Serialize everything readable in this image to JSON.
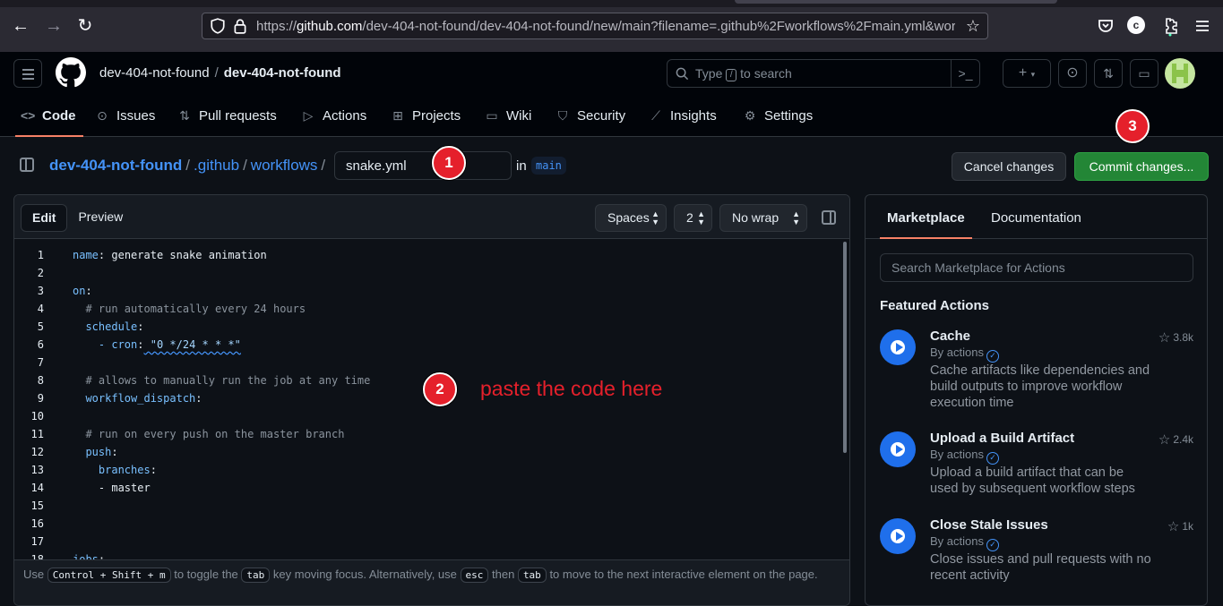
{
  "browser": {
    "url_prefix": "https://",
    "url_host": "github.com",
    "url_path": "/dev-404-not-found/dev-404-not-found/new/main?filename=.github%2Fworkflows%2Fmain.yml&wor",
    "profile_letter": "c"
  },
  "header": {
    "owner": "dev-404-not-found",
    "separator": "/",
    "repo": "dev-404-not-found",
    "search_prefix": "Type",
    "search_key": "/",
    "search_suffix": "to search"
  },
  "repo_nav": [
    {
      "label": "Code",
      "icon": "code-icon",
      "glyph": "<>"
    },
    {
      "label": "Issues",
      "icon": "issue-icon",
      "glyph": "⊙"
    },
    {
      "label": "Pull requests",
      "icon": "pull-request-icon",
      "glyph": "⇅"
    },
    {
      "label": "Actions",
      "icon": "play-icon",
      "glyph": "▷"
    },
    {
      "label": "Projects",
      "icon": "table-icon",
      "glyph": "⊞"
    },
    {
      "label": "Wiki",
      "icon": "book-icon",
      "glyph": "▭"
    },
    {
      "label": "Security",
      "icon": "shield-icon",
      "glyph": "⛉"
    },
    {
      "label": "Insights",
      "icon": "graph-icon",
      "glyph": "⟋"
    },
    {
      "label": "Settings",
      "icon": "gear-icon",
      "glyph": "⚙"
    }
  ],
  "file_bar": {
    "crumbs": [
      "dev-404-not-found",
      ".github",
      "workflows"
    ],
    "separator": "/",
    "filename": "snake.yml",
    "in_label": "in",
    "branch": "main",
    "cancel_label": "Cancel changes",
    "commit_label": "Commit changes..."
  },
  "editor": {
    "edit_tab": "Edit",
    "preview_tab": "Preview",
    "indent_mode": "Spaces",
    "indent_size": "2",
    "wrap_mode": "No wrap",
    "lines": [
      {
        "n": "1",
        "indent": "",
        "key": "name",
        "punct": ":",
        "val": " generate snake animation",
        "type": "kv"
      },
      {
        "n": "2",
        "indent": "",
        "type": "blank"
      },
      {
        "n": "3",
        "indent": "",
        "key": "on",
        "punct": ":",
        "val": "",
        "type": "kv"
      },
      {
        "n": "4",
        "indent": "  ",
        "comment": "# run automatically every 24 hours",
        "type": "comment"
      },
      {
        "n": "5",
        "indent": "  ",
        "key": "schedule",
        "punct": ":",
        "val": "",
        "type": "kv"
      },
      {
        "n": "6",
        "indent": "    ",
        "key": "- cron",
        "punct": ":",
        "val": " \"0 */24 * * *\"",
        "type": "cron"
      },
      {
        "n": "7",
        "indent": "",
        "type": "blank"
      },
      {
        "n": "8",
        "indent": "  ",
        "comment": "# allows to manually run the job at any time",
        "type": "comment"
      },
      {
        "n": "9",
        "indent": "  ",
        "key": "workflow_dispatch",
        "punct": ":",
        "val": "",
        "type": "kv"
      },
      {
        "n": "10",
        "indent": "",
        "type": "blank"
      },
      {
        "n": "11",
        "indent": "  ",
        "comment": "# run on every push on the master branch",
        "type": "comment"
      },
      {
        "n": "12",
        "indent": "  ",
        "key": "push",
        "punct": ":",
        "val": "",
        "type": "kv"
      },
      {
        "n": "13",
        "indent": "    ",
        "key": "branches",
        "punct": ":",
        "val": "",
        "type": "kv"
      },
      {
        "n": "14",
        "indent": "    ",
        "key": "",
        "punct": "",
        "val": "- master",
        "type": "plain"
      },
      {
        "n": "15",
        "indent": "",
        "type": "blank"
      },
      {
        "n": "16",
        "indent": "",
        "type": "blank"
      },
      {
        "n": "17",
        "indent": "",
        "type": "blank"
      },
      {
        "n": "18",
        "indent": "",
        "key": "jobs",
        "punct": ":",
        "val": "",
        "type": "kv"
      }
    ],
    "footer": {
      "t1": "Use",
      "k1": "Control + Shift + m",
      "t2": "to toggle the",
      "k2": "tab",
      "t3": "key moving focus. Alternatively, use",
      "k3": "esc",
      "t4": "then",
      "k4": "tab",
      "t5": "to move to the next interactive element on the page."
    }
  },
  "annotations": {
    "one": "1",
    "two": "2",
    "three": "3",
    "paste_note": "paste the code here"
  },
  "sidebar": {
    "tab_marketplace": "Marketplace",
    "tab_docs": "Documentation",
    "search_placeholder": "Search Marketplace for Actions",
    "featured_heading": "Featured Actions",
    "actions": [
      {
        "title": "Cache",
        "by": "By actions",
        "desc": "Cache artifacts like dependencies and build outputs to improve workflow execution time",
        "stars": "3.8k"
      },
      {
        "title": "Upload a Build Artifact",
        "by": "By actions",
        "desc": "Upload a build artifact that can be used by subsequent workflow steps",
        "stars": "2.4k"
      },
      {
        "title": "Close Stale Issues",
        "by": "By actions",
        "desc": "Close issues and pull requests with no recent activity",
        "stars": "1k"
      }
    ]
  },
  "colors": {
    "accent_blue": "#4493f8",
    "commit_green": "#238636",
    "annotation_red": "#e5202b",
    "tab_underline": "#f78166"
  }
}
